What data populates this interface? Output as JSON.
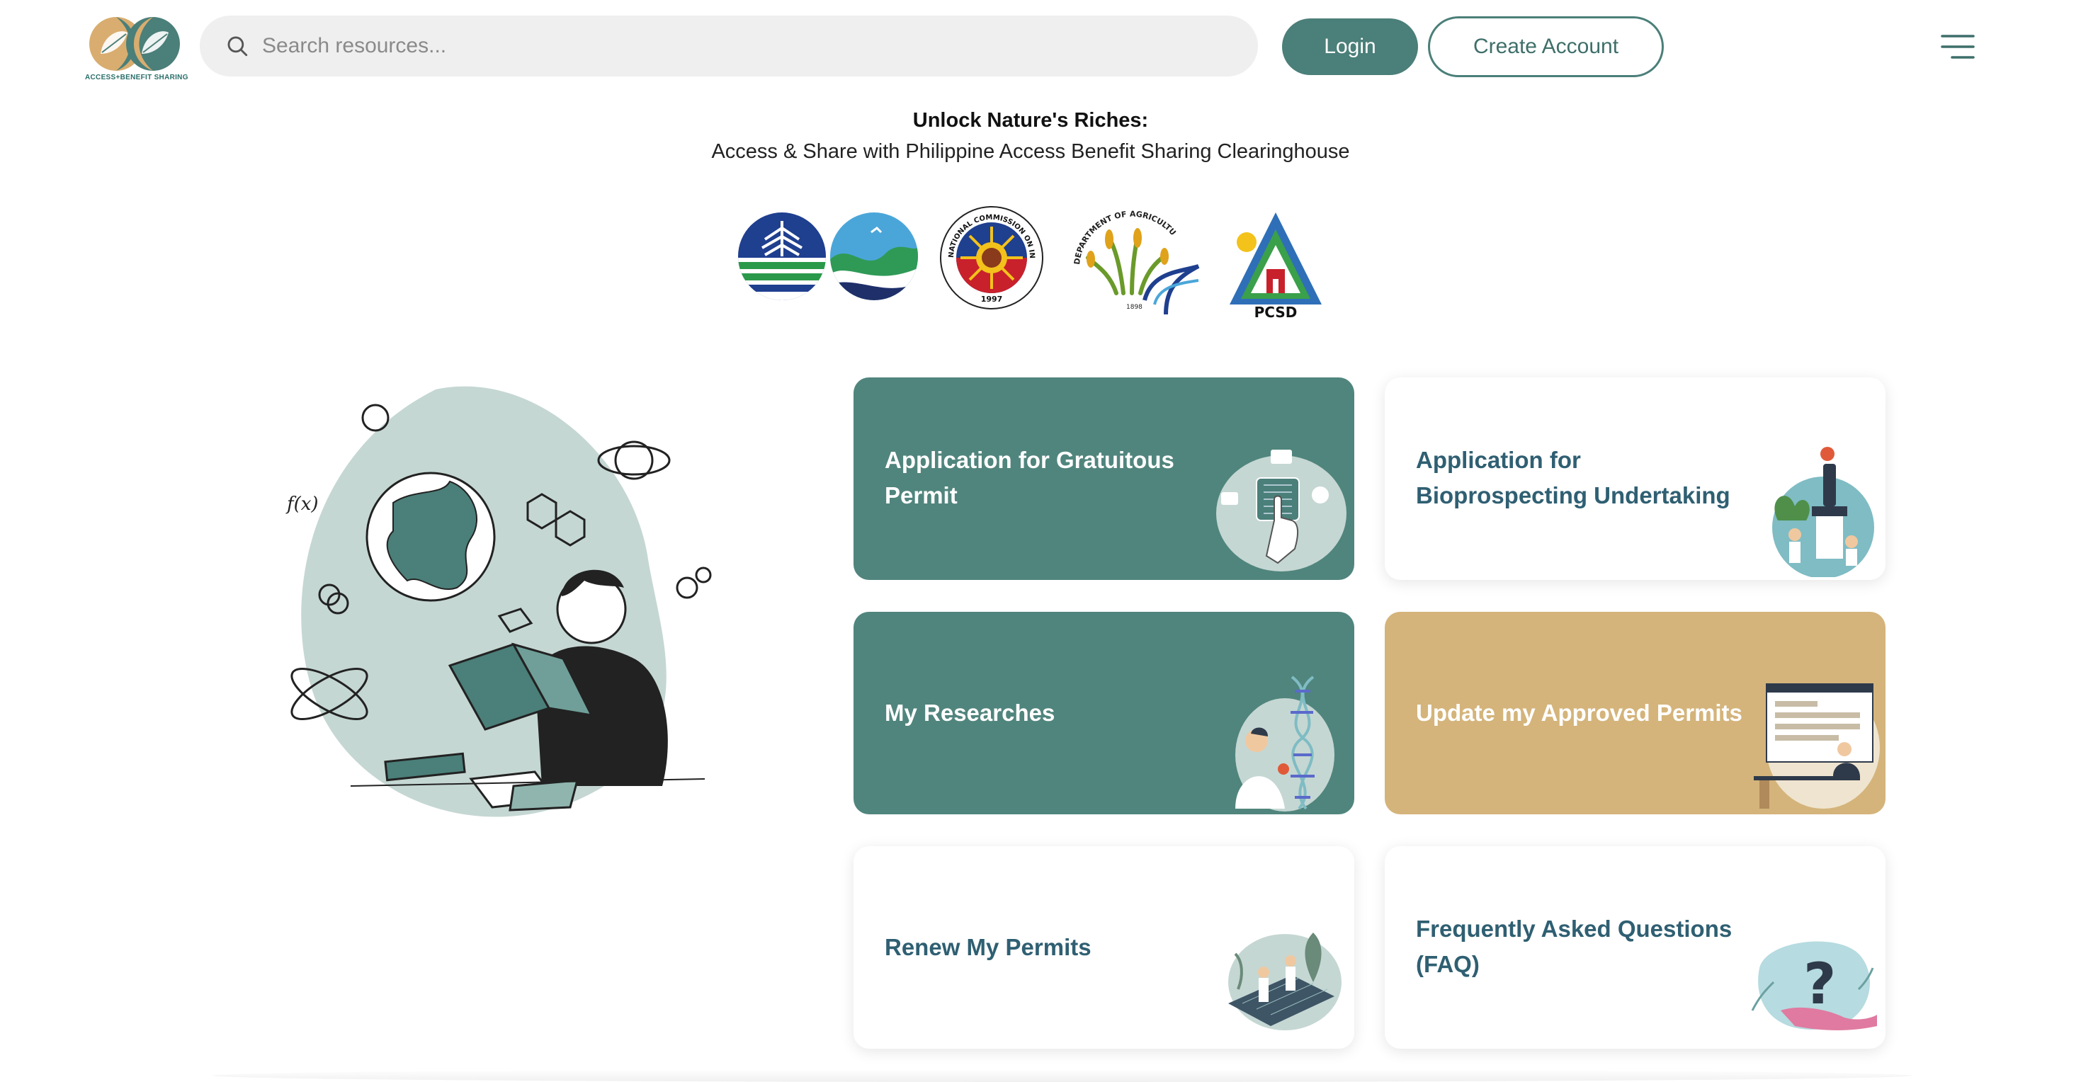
{
  "header": {
    "logo_text": "ACCESS+BENEFIT SHARING",
    "search_placeholder": "Search resources...",
    "login_label": "Login",
    "create_account_label": "Create Account"
  },
  "hero": {
    "title": "Unlock Nature's Riches:",
    "subtitle": "Access & Share with Philippine Access Benefit Sharing Clearinghouse"
  },
  "agencies": {
    "ncip_ring_text": "NATIONAL COMMISSION ON INDIGENOUS PEOPLES",
    "ncip_year": "1997",
    "da_ring_text": "DEPARTMENT OF AGRICULTURE",
    "da_year": "1898",
    "pcsd_label": "PCSD"
  },
  "cards": [
    {
      "label": "Application for Gratuitous Permit",
      "icon": "fingerprint-scan-icon",
      "style": "green"
    },
    {
      "label": "Application for Bioprospecting Undertaking",
      "icon": "microscope-lab-icon",
      "style": "white"
    },
    {
      "label": "My Researches",
      "icon": "dna-researcher-icon",
      "style": "green"
    },
    {
      "label": "Update my Approved Permits",
      "icon": "web-form-icon",
      "style": "gold"
    },
    {
      "label": "Renew My Permits",
      "icon": "team-documents-icon",
      "style": "white"
    },
    {
      "label": "Frequently Asked Questions (FAQ)",
      "icon": "question-hand-icon",
      "style": "white"
    }
  ],
  "colors": {
    "primary_green": "#50857d",
    "button_green": "#4b7f79",
    "gold": "#d4b47b",
    "card_text_dark": "#2f5f72"
  }
}
